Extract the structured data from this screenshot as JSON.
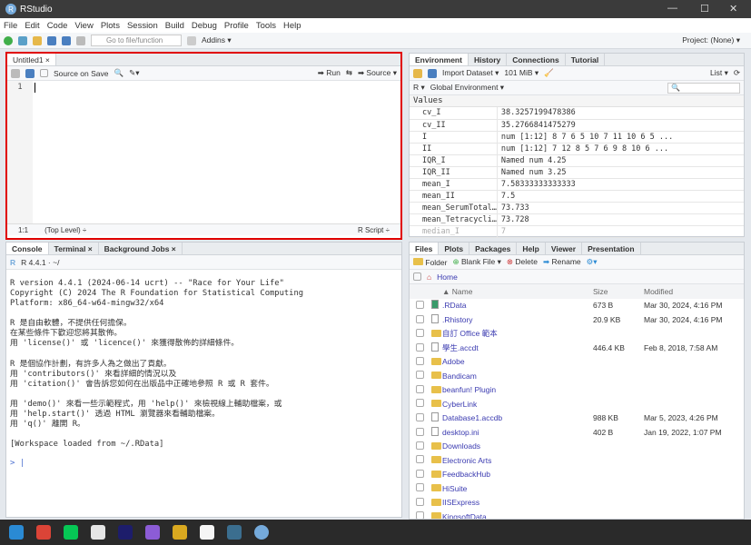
{
  "window": {
    "title": "RStudio",
    "minimize": "—",
    "maximize": "☐",
    "close": "✕"
  },
  "menu": [
    "File",
    "Edit",
    "Code",
    "View",
    "Plots",
    "Session",
    "Build",
    "Debug",
    "Profile",
    "Tools",
    "Help"
  ],
  "toolbar": {
    "goto_placeholder": "Go to file/function",
    "addins": "Addins ▾",
    "project": "Project: (None) ▾"
  },
  "source": {
    "tab": "Untitled1",
    "source_on_save": "Source on Save",
    "run": "Run",
    "source_btn": "Source",
    "line_number": "1",
    "status_pos": "1:1",
    "status_scope": "(Top Level) ÷",
    "status_type": "R Script ÷",
    "highlight_color": "#e00000"
  },
  "environment": {
    "tabs": [
      "Environment",
      "History",
      "Connections",
      "Tutorial"
    ],
    "import": "Import Dataset ▾",
    "memory": "101 MiB ▾",
    "view": "List ▾",
    "lang": "R ▾",
    "scope": "Global Environment ▾",
    "section": "Values",
    "rows": [
      [
        "cv_I",
        "38.3257199478386"
      ],
      [
        "cv_II",
        "35.2766841475279"
      ],
      [
        "I",
        "num [1:12] 8 7 6 5 10 7 11 10 6 5 ..."
      ],
      [
        "II",
        "num [1:12] 7 12 8 5 7 6 9 8 10 6 ..."
      ],
      [
        "IQR_I",
        "Named num 4.25"
      ],
      [
        "IQR_II",
        "Named num 3.25"
      ],
      [
        "mean_I",
        "7.58333333333333"
      ],
      [
        "mean_II",
        "7.5"
      ],
      [
        "mean_SerumTotal…",
        "73.733"
      ],
      [
        "mean_Tetracycli…",
        "73.728"
      ],
      [
        "median_I",
        "7"
      ]
    ]
  },
  "console": {
    "tabs": [
      "Console",
      "Terminal ×",
      "Background Jobs ×"
    ],
    "version": "R 4.4.1 · ~/",
    "lines": [
      "R version 4.4.1 (2024-06-14 ucrt) -- \"Race for Your Life\"",
      "Copyright (C) 2024 The R Foundation for Statistical Computing",
      "Platform: x86_64-w64-mingw32/x64",
      "",
      "R 是自由軟體，不提供任何擔保。",
      "在某些條件下歡迎您將其散佈。",
      "用 'license()' 或 'licence()' 來獲得散佈的詳細條件。",
      "",
      "R 是個協作計劃，有許多人為之做出了貢獻。",
      "用 'contributors()' 來看詳細的情況以及",
      "用 'citation()' 會告訴您如何在出版品中正確地參照 R 或 R 套件。",
      "",
      "用 'demo()' 來看一些示範程式，用 'help()' 來檢視線上輔助檔案，或",
      "用 'help.start()' 透過 HTML 瀏覽器來看輔助檔案。",
      "用 'q()' 離開 R。",
      "",
      "[Workspace loaded from ~/.RData]"
    ],
    "prompt": ">"
  },
  "files": {
    "tabs": [
      "Files",
      "Plots",
      "Packages",
      "Help",
      "Viewer",
      "Presentation"
    ],
    "folder": "Folder",
    "blank": "Blank File ▾",
    "delete": "Delete",
    "rename": "Rename",
    "home": "Home",
    "headers": [
      "▲ Name",
      "Size",
      "Modified"
    ],
    "rows": [
      {
        "icon": "rdata",
        "name": ".RData",
        "size": "673 B",
        "mod": "Mar 30, 2024, 4:16 PM"
      },
      {
        "icon": "rhistory",
        "name": ".Rhistory",
        "size": "20.9 KB",
        "mod": "Mar 30, 2024, 4:16 PM"
      },
      {
        "icon": "folder",
        "name": "自訂 Office 範本",
        "size": "",
        "mod": ""
      },
      {
        "icon": "file",
        "name": "學生.accdt",
        "size": "446.4 KB",
        "mod": "Feb 8, 2018, 7:58 AM"
      },
      {
        "icon": "folder",
        "name": "Adobe",
        "size": "",
        "mod": ""
      },
      {
        "icon": "folder",
        "name": "Bandicam",
        "size": "",
        "mod": ""
      },
      {
        "icon": "folder",
        "name": "beanfun! Plugin",
        "size": "",
        "mod": ""
      },
      {
        "icon": "folder",
        "name": "CyberLink",
        "size": "",
        "mod": ""
      },
      {
        "icon": "file",
        "name": "Database1.accdb",
        "size": "988 KB",
        "mod": "Mar 5, 2023, 4:26 PM"
      },
      {
        "icon": "settings-file",
        "name": "desktop.ini",
        "size": "402 B",
        "mod": "Jan 19, 2022, 1:07 PM"
      },
      {
        "icon": "folder",
        "name": "Downloads",
        "size": "",
        "mod": ""
      },
      {
        "icon": "folder",
        "name": "Electronic Arts",
        "size": "",
        "mod": ""
      },
      {
        "icon": "folder",
        "name": "FeedbackHub",
        "size": "",
        "mod": ""
      },
      {
        "icon": "folder",
        "name": "HiSuite",
        "size": "",
        "mod": ""
      },
      {
        "icon": "folder",
        "name": "IISExpress",
        "size": "",
        "mod": ""
      },
      {
        "icon": "folder",
        "name": "KingsoftData",
        "size": "",
        "mod": ""
      }
    ]
  },
  "taskbar": {
    "apps": [
      "mail",
      "chrome",
      "line",
      "paint",
      "intellij",
      "visual-studio",
      "app",
      "notepad",
      "mysql",
      "rstudio"
    ],
    "colors": [
      "#2a8ad4",
      "#db4437",
      "#06c755",
      "#e5e5e5",
      "#1d1d6b",
      "#8c5cd6",
      "#d9a820",
      "#f5f5f5",
      "#3b6e8f",
      "#75aadb"
    ]
  }
}
